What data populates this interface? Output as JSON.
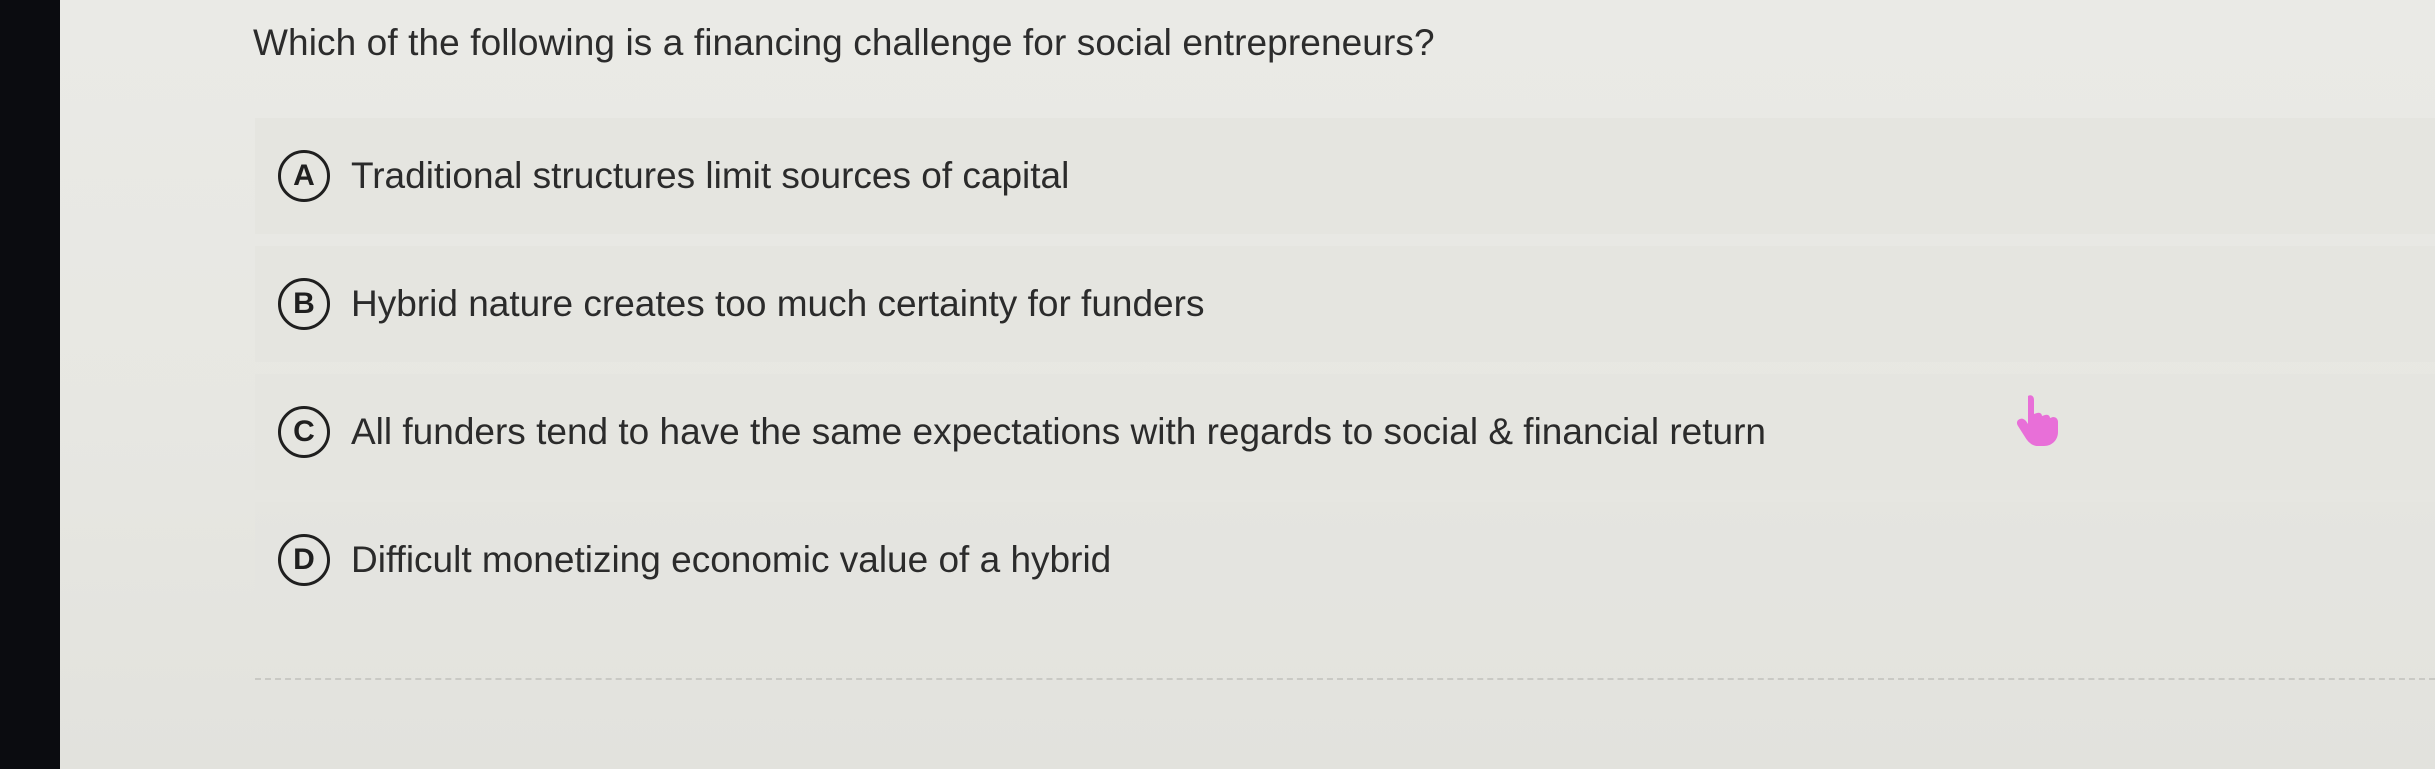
{
  "question": "Which of the following is a financing challenge for social entrepreneurs?",
  "options": [
    {
      "letter": "A",
      "text": "Traditional structures limit sources of capital"
    },
    {
      "letter": "B",
      "text": "Hybrid nature creates too much certainty for funders"
    },
    {
      "letter": "C",
      "text": "All funders tend to have the same expectations with regards to social & financial return"
    },
    {
      "letter": "D",
      "text": "Difficult monetizing economic value of a hybrid"
    }
  ],
  "cursor": {
    "icon": "hand-pointer-icon",
    "color": "#e86fd8"
  }
}
